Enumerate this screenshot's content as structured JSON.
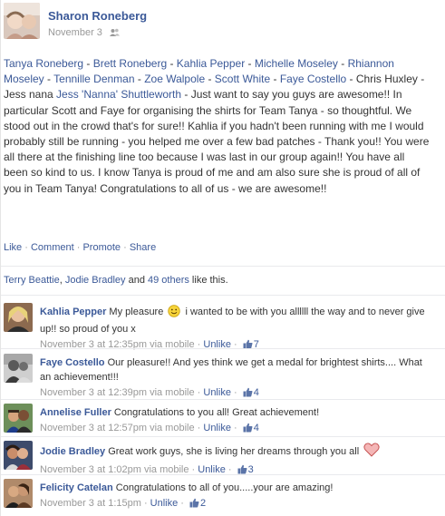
{
  "post": {
    "author": "Sharon Roneberg",
    "date": "November 3",
    "audience_icon": "friends-icon",
    "tagged": [
      "Tanya Roneberg",
      "Brett Roneberg",
      "Kahlia Pepper",
      "Michelle Moseley",
      "Rhiannon Moseley",
      "Tennille Denman",
      "Zoe Walpole",
      "Scott White",
      "Faye Costello"
    ],
    "plain_name": "Chris Huxley",
    "plain_name2": "Jess nana",
    "tagged_last": "Jess 'Nanna' Shuttleworth",
    "separator": " - ",
    "message": " - Just want to say you guys are awesome!! In particular Scott and Faye for organising the shirts for Team Tanya - so thoughtful. We stood out in the crowd that's for sure!! Kahlia if you hadn't been running with me I would probably still be running - you helped me over a few bad patches - Thank you!! You were all there at the finishing line too because I was last in our group again!! You have all been so kind to us. I know Tanya is proud of me and am also sure she is proud of all of you in Team Tanya! Congratulations to all of us - we are awesome!!"
  },
  "actions": {
    "like": "Like",
    "comment": "Comment",
    "promote": "Promote",
    "share": "Share",
    "sep": "·"
  },
  "likes": {
    "name1": "Terry Beattie",
    "comma": ", ",
    "name2": "Jodie Bradley",
    "and": " and ",
    "others": "49 others",
    "suffix": " like this."
  },
  "comments": [
    {
      "name": "Kahlia Pepper",
      "text_before": "My pleasure ",
      "emoji": "smiley-icon",
      "text_after": " i wanted to be with you allllll the way and to never give up!! so proud of you x",
      "time": "November 3 at 12:35pm via mobile",
      "unlike": "Unlike",
      "likes": "7"
    },
    {
      "name": "Faye Costello",
      "text_before": "Our pleasure!! And yes think we get a medal for brightest shirts.... What an achievement!!!",
      "time": "November 3 at 12:39pm via mobile",
      "unlike": "Unlike",
      "likes": "4"
    },
    {
      "name": "Annelise Fuller",
      "text_before": "Congratulations to you all! Great achievement!",
      "time": "November 3 at 12:57pm via mobile",
      "unlike": "Unlike",
      "likes": "4"
    },
    {
      "name": "Jodie Bradley",
      "text_before": "Great work guys, she is living her dreams through you all ",
      "emoji": "heart-icon",
      "time": "November 3 at 1:02pm via mobile",
      "unlike": "Unlike",
      "likes": "3"
    },
    {
      "name": "Felicity Catelan",
      "text_before": "Congratulations to all of you.....your are amazing!",
      "time": "November 3 at 1:15pm",
      "unlike": "Unlike",
      "likes": "2"
    }
  ],
  "colors": {
    "link": "#3b5998",
    "meta": "#999999",
    "text": "#333333"
  }
}
